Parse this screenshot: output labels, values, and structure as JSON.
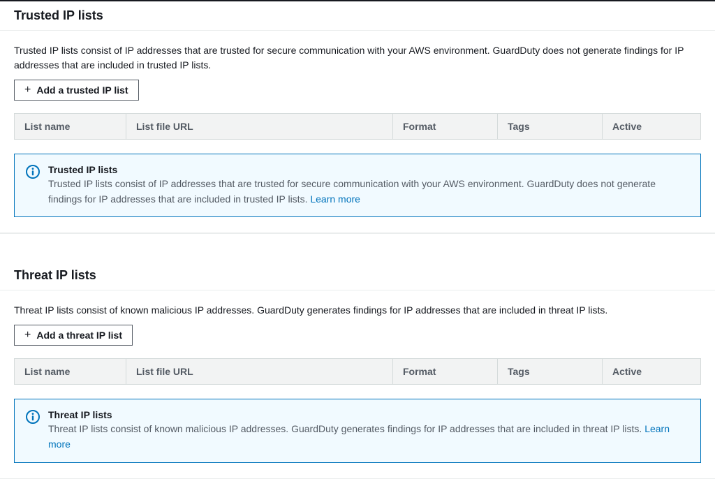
{
  "trusted": {
    "header": "Trusted IP lists",
    "description": "Trusted IP lists consist of IP addresses that are trusted for secure communication with your AWS environment. GuardDuty does not generate findings for IP addresses that are included in trusted IP lists.",
    "add_button": "Add a trusted IP list",
    "columns": {
      "name": "List name",
      "url": "List file URL",
      "format": "Format",
      "tags": "Tags",
      "active": "Active"
    },
    "info": {
      "title": "Trusted IP lists",
      "text": "Trusted IP lists consist of IP addresses that are trusted for secure communication with your AWS environment. GuardDuty does not generate findings for IP addresses that are included in trusted IP lists. ",
      "learn_more": "Learn more"
    }
  },
  "threat": {
    "header": "Threat IP lists",
    "description": "Threat IP lists consist of known malicious IP addresses. GuardDuty generates findings for IP addresses that are included in threat IP lists.",
    "add_button": "Add a threat IP list",
    "columns": {
      "name": "List name",
      "url": "List file URL",
      "format": "Format",
      "tags": "Tags",
      "active": "Active"
    },
    "info": {
      "title": "Threat IP lists",
      "text": "Threat IP lists consist of known malicious IP addresses. GuardDuty generates findings for IP addresses that are included in threat IP lists. ",
      "learn_more": "Learn more"
    }
  }
}
